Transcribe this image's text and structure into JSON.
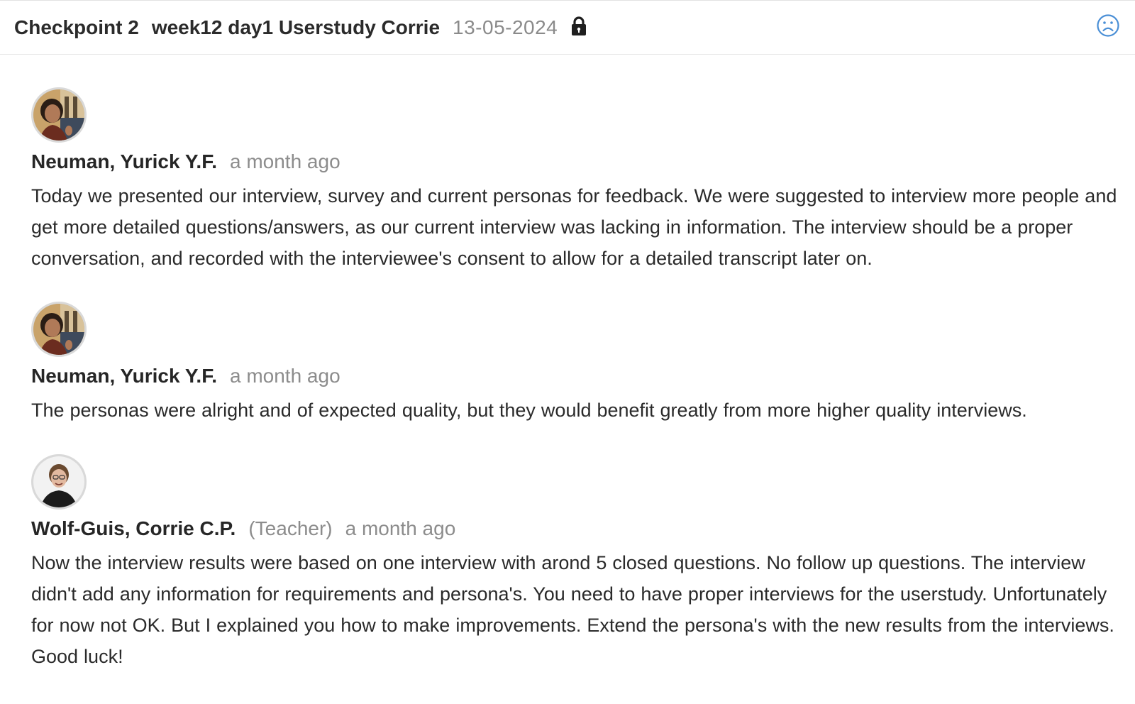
{
  "header": {
    "checkpoint": "Checkpoint 2",
    "assignment": "week12 day1 Userstudy Corrie",
    "date": "13-05-2024",
    "lock_icon": "lock-icon",
    "status_icon": "sad-face-icon"
  },
  "comments": [
    {
      "author": "Neuman, Yurick Y.F.",
      "role": "",
      "time": "a month ago",
      "text": "Today we presented our interview, survey and current personas for feedback. We were suggested to interview more people and get more detailed questions/answers, as our current interview was lacking in information. The interview should be a proper conversation, and recorded with the interviewee's consent to allow for a detailed transcript later on."
    },
    {
      "author": "Neuman, Yurick Y.F.",
      "role": "",
      "time": "a month ago",
      "text": "The personas were alright and of expected quality, but they would benefit greatly from more higher quality interviews."
    },
    {
      "author": "Wolf-Guis, Corrie C.P.",
      "role": "(Teacher)",
      "time": "a month ago",
      "text": "Now the interview results were based on one interview with arond 5 closed questions. No follow up questions. The interview didn't add any information for requirements and persona's. You need to have proper interviews for the userstudy. Unfortunately for now not OK. But I explained you how to make improvements. Extend the persona's with the new results from the interviews. Good luck!"
    }
  ],
  "colors": {
    "status_icon": "#4a8fd6",
    "muted_text": "#8c8c8c"
  }
}
